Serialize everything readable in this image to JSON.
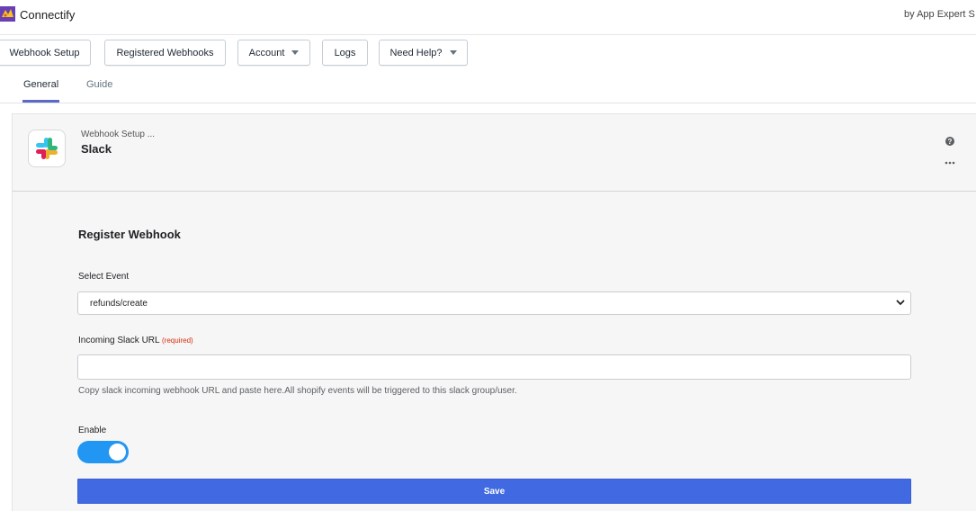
{
  "app": {
    "title": "Connectify",
    "vendor": "by App Expert S"
  },
  "toolbar": {
    "webhook_setup": "Webhook Setup",
    "registered_webhooks": "Registered Webhooks",
    "account": "Account",
    "logs": "Logs",
    "need_help": "Need Help?"
  },
  "tabs": {
    "general": "General",
    "guide": "Guide"
  },
  "card": {
    "breadcrumb": "Webhook Setup ...",
    "title": "Slack",
    "icon": "slack-logo"
  },
  "form": {
    "title": "Register Webhook",
    "select_event_label": "Select Event",
    "select_event_value": "refunds/create",
    "slack_url_label": "Incoming Slack URL",
    "required_note": "(required)",
    "slack_url_value": "",
    "help_text": "Copy slack incoming webhook URL and paste here.All shopify events will be triggered to this slack group/user.",
    "enable_label": "Enable",
    "enabled": true,
    "save_label": "Save"
  },
  "colors": {
    "accent": "#5c6ac4",
    "toggle_on": "#2196f3",
    "save_button": "#4169e1",
    "required": "#d72c0d"
  }
}
